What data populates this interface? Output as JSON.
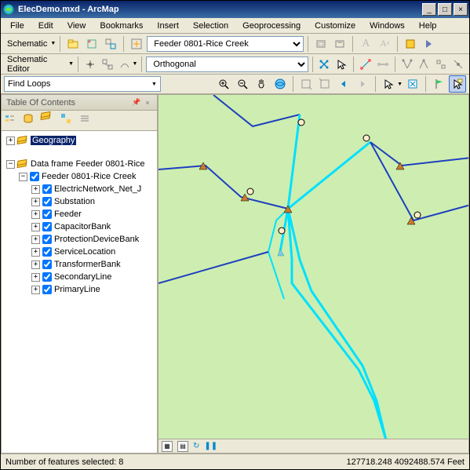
{
  "titlebar": {
    "title": "ElecDemo.mxd - ArcMap"
  },
  "menubar": {
    "items": [
      "File",
      "Edit",
      "View",
      "Bookmarks",
      "Insert",
      "Selection",
      "Geoprocessing",
      "Customize",
      "Windows",
      "Help"
    ]
  },
  "toolbar1": {
    "schematic_label": "Schematic",
    "feeder_value": "Feeder 0801-Rice Creek"
  },
  "toolbar2": {
    "editor_label": "Schematic Editor",
    "ortho_value": "Orthogonal"
  },
  "findbox": {
    "value": "Find Loops"
  },
  "toc": {
    "title": "Table Of Contents",
    "root": "Geography",
    "df": "Data frame Feeder 0801-Rice",
    "feeder": "Feeder 0801-Rice Creek",
    "layers": [
      "ElectricNetwork_Net_J",
      "Substation",
      "Feeder",
      "CapacitorBank",
      "ProtectionDeviceBank",
      "ServiceLocation",
      "TransformerBank",
      "SecondaryLine",
      "PrimaryLine"
    ]
  },
  "status": {
    "left": "Number of features selected: 8",
    "right": "127718.248 4092488.574 Feet"
  }
}
